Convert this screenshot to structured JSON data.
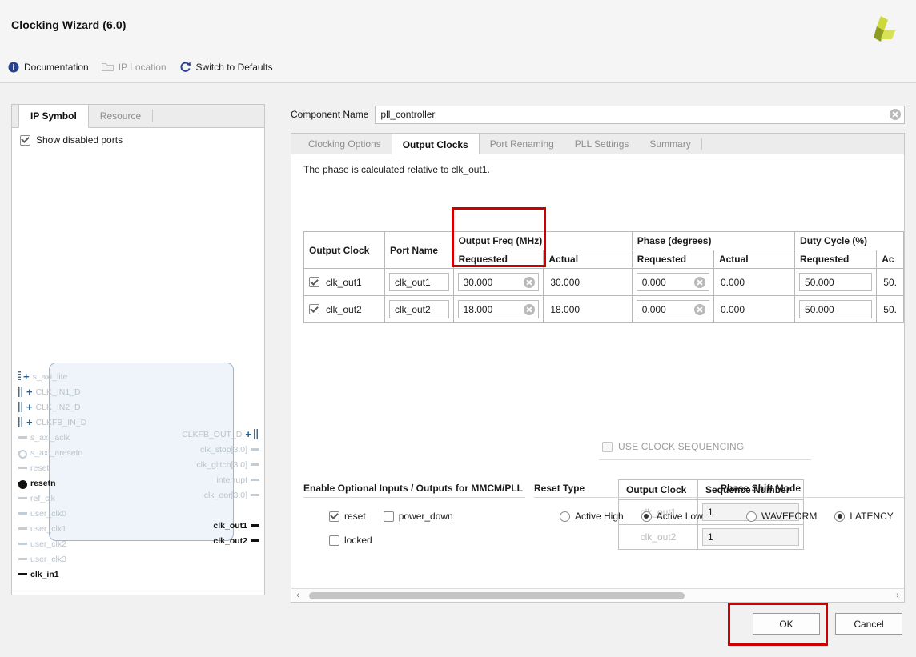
{
  "window": {
    "title": "Clocking Wizard (6.0)",
    "logo_colors": [
      "#c8d42e",
      "#8a9a22",
      "#d9e34d"
    ]
  },
  "toolbar": {
    "items": [
      {
        "label": "Documentation",
        "icon": "info-icon",
        "enabled": true
      },
      {
        "label": "IP Location",
        "icon": "folder-icon",
        "enabled": false
      },
      {
        "label": "Switch to Defaults",
        "icon": "refresh-icon",
        "enabled": true
      }
    ]
  },
  "left_panel": {
    "tabs": [
      {
        "label": "IP Symbol",
        "active": true
      },
      {
        "label": "Resource",
        "active": false
      }
    ],
    "show_disabled_ports": {
      "label": "Show disabled ports",
      "checked": true
    },
    "symbol": {
      "left_ports": [
        {
          "name": "s_axi_lite",
          "type": "bus",
          "enabled": false,
          "connector": "dotted"
        },
        {
          "name": "CLK_IN1_D",
          "type": "bus",
          "enabled": false,
          "connector": "bars"
        },
        {
          "name": "CLK_IN2_D",
          "type": "bus",
          "enabled": false,
          "connector": "bars"
        },
        {
          "name": "CLKFB_IN_D",
          "type": "bus",
          "enabled": false,
          "connector": "bars"
        },
        {
          "name": "s_axi_aclk",
          "type": "pin",
          "enabled": false
        },
        {
          "name": "s_axi_aresetn",
          "type": "pin-inverted",
          "enabled": false
        },
        {
          "name": "reset",
          "type": "pin",
          "enabled": false
        },
        {
          "name": "resetn",
          "type": "pin-inverted",
          "enabled": true
        },
        {
          "name": "ref_clk",
          "type": "pin",
          "enabled": false
        },
        {
          "name": "user_clk0",
          "type": "pin",
          "enabled": false
        },
        {
          "name": "user_clk1",
          "type": "pin",
          "enabled": false
        },
        {
          "name": "user_clk2",
          "type": "pin",
          "enabled": false
        },
        {
          "name": "user_clk3",
          "type": "pin",
          "enabled": false
        },
        {
          "name": "clk_in1",
          "type": "pin",
          "enabled": true
        }
      ],
      "right_ports": [
        {
          "name": "CLKFB_OUT_D",
          "type": "bus",
          "enabled": false,
          "connector": "bars"
        },
        {
          "name": "clk_stop[3:0]",
          "type": "pin",
          "enabled": false
        },
        {
          "name": "clk_glitch[3:0]",
          "type": "pin",
          "enabled": false
        },
        {
          "name": "interrupt",
          "type": "pin",
          "enabled": false
        },
        {
          "name": "clk_oor[3:0]",
          "type": "pin",
          "enabled": false
        },
        {
          "name": "clk_out1",
          "type": "pin",
          "enabled": true
        },
        {
          "name": "clk_out2",
          "type": "pin",
          "enabled": true
        }
      ]
    }
  },
  "component_name": {
    "label": "Component Name",
    "value": "pll_controller",
    "clear_icon": "clear-icon"
  },
  "tabs": [
    {
      "label": "Clocking Options",
      "active": false
    },
    {
      "label": "Output Clocks",
      "active": true
    },
    {
      "label": "Port Renaming",
      "active": false
    },
    {
      "label": "PLL Settings",
      "active": false
    },
    {
      "label": "Summary",
      "active": false
    }
  ],
  "output_clocks": {
    "note": "The phase is calculated relative to clk_out1.",
    "group_headers": {
      "output_clock": "Output Clock",
      "port_name": "Port Name",
      "output_freq": "Output Freq (MHz)",
      "phase": "Phase (degrees)",
      "duty_cycle": "Duty Cycle (%)"
    },
    "sub_headers": {
      "requested": "Requested",
      "actual": "Actual",
      "actual_clipped": "Ac"
    },
    "rows": [
      {
        "enabled": true,
        "clock": "clk_out1",
        "port_name": "clk_out1",
        "freq_requested": "30.000",
        "freq_actual": "30.000",
        "phase_requested": "0.000",
        "phase_actual": "0.000",
        "duty_requested": "50.000",
        "duty_actual": "50."
      },
      {
        "enabled": true,
        "clock": "clk_out2",
        "port_name": "clk_out2",
        "freq_requested": "18.000",
        "freq_actual": "18.000",
        "phase_requested": "0.000",
        "phase_actual": "0.000",
        "duty_requested": "50.000",
        "duty_actual": "50."
      }
    ]
  },
  "sequencing": {
    "checkbox_label": "USE CLOCK SEQUENCING",
    "checked": false,
    "enabled": false,
    "headers": {
      "clock": "Output Clock",
      "sequence": "Sequence Number"
    },
    "rows": [
      {
        "clock": "clk_out1",
        "sequence": "1"
      },
      {
        "clock": "clk_out2",
        "sequence": "1"
      }
    ]
  },
  "optional_io": {
    "title": "Enable Optional Inputs / Outputs for MMCM/PLL",
    "items": [
      {
        "label": "reset",
        "checked": true
      },
      {
        "label": "power_down",
        "checked": false
      },
      {
        "label": "locked",
        "checked": false
      }
    ]
  },
  "reset_type": {
    "title": "Reset Type",
    "options": [
      {
        "label": "Active High",
        "selected": false
      },
      {
        "label": "Active Low",
        "selected": true
      }
    ]
  },
  "phase_shift_mode": {
    "title": "Phase Shift Mode",
    "options": [
      {
        "label": "WAVEFORM",
        "selected": false
      },
      {
        "label": "LATENCY",
        "selected": true
      }
    ]
  },
  "scrollbar": {
    "left_arrow": "‹",
    "right_arrow": "›",
    "thumb_percent": 64
  },
  "footer": {
    "ok": "OK",
    "cancel": "Cancel"
  },
  "annotations": {
    "color": "#cc0000",
    "targets": [
      "output-freq-requested-column",
      "ok-button"
    ]
  }
}
